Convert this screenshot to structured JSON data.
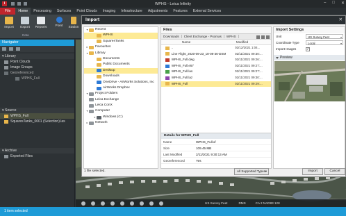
{
  "app": {
    "title": "WPHS - Leica Infinity",
    "app_icon": "i"
  },
  "ribbon": {
    "tabs": [
      "File",
      "Home",
      "Processing",
      "Surfaces",
      "Point Clouds",
      "Imaging",
      "Infrastructure",
      "Adjustments",
      "Features",
      "External Services"
    ],
    "active_tab": "Home",
    "buttons": [
      {
        "label": "Import",
        "icon": "import-icon"
      },
      {
        "label": "Export",
        "icon": "export-icon"
      },
      {
        "label": "Reports",
        "icon": "reports-icon"
      },
      {
        "label": "Point",
        "icon": "point-icon"
      },
      {
        "label": "Station",
        "icon": "station-icon"
      }
    ],
    "group_label": "Data"
  },
  "navigator": {
    "title": "Navigator",
    "library": {
      "label": "Library",
      "items": [
        "Point Clouds",
        "Image Groups",
        "Georeferenced",
        "WPHS_Full"
      ]
    },
    "source": {
      "label": "Source",
      "items": [
        "WPHS_Full",
        "SquaresTanks_0001 (Selection).las"
      ]
    },
    "archive": {
      "label": "Archive",
      "items": [
        "Exported Files"
      ]
    }
  },
  "dialog": {
    "title": "Import",
    "tree": [
      {
        "label": "Recent",
        "icon": "folder",
        "level": 0,
        "arrow": "▾"
      },
      {
        "label": "WPHS",
        "icon": "folder",
        "level": 1,
        "selected": true
      },
      {
        "label": "SquaresTanks",
        "icon": "folder",
        "level": 1
      },
      {
        "label": "Favourites",
        "icon": "folder",
        "level": 0,
        "arrow": "▸"
      },
      {
        "label": "Library",
        "icon": "folder",
        "level": 0,
        "arrow": "▾"
      },
      {
        "label": "Documents",
        "icon": "folder",
        "level": 1
      },
      {
        "label": "Public Documents",
        "icon": "folder",
        "level": 1
      },
      {
        "label": "Desktop",
        "icon": "folder-blue",
        "level": 1,
        "selected": true
      },
      {
        "label": "Downloads",
        "icon": "folder",
        "level": 1
      },
      {
        "label": "OneDrive - AirWorks Solutions, Inc",
        "icon": "cloud-blue",
        "level": 1
      },
      {
        "label": "AirWorks Dropbox",
        "icon": "folder-blue",
        "level": 1
      },
      {
        "label": "Project Folders",
        "icon": "folder-gray",
        "level": 0,
        "arrow": "▾"
      },
      {
        "label": "Leica Exchange",
        "icon": "folder-gray",
        "level": 0
      },
      {
        "label": "Leica ConX",
        "icon": "folder-gray",
        "level": 0
      },
      {
        "label": "Computer",
        "icon": "folder-gray",
        "level": 0,
        "arrow": "▾"
      },
      {
        "label": "Windows (C:)",
        "icon": "drive",
        "level": 1,
        "arrow": "▸"
      },
      {
        "label": "Network",
        "icon": "folder-gray",
        "level": 0,
        "arrow": "▸"
      }
    ],
    "files": {
      "title": "Files",
      "breadcrumbs": [
        "Downloads",
        "Client Exchange - Psomas",
        "WPHS"
      ],
      "columns": [
        "Name",
        "Modified"
      ],
      "rows": [
        {
          "name": "..",
          "modified": "02/12/2021 1:04...",
          "icon": "folder"
        },
        {
          "name": "Line Flight_2020-09-23_18-08-36-DSM",
          "modified": "02/11/2021 09:30:...",
          "icon": "folder"
        },
        {
          "name": "WPHS_Full.dwg",
          "modified": "02/11/2021 09:26:...",
          "icon": "file-dwg"
        },
        {
          "name": "WPHS_Full.e57",
          "modified": "02/11/2021 09:27:...",
          "icon": "file-e57"
        },
        {
          "name": "WPHS_Full.las",
          "modified": "02/11/2021 09:27:...",
          "icon": "file-las"
        },
        {
          "name": "WPHS_Full.laz",
          "modified": "02/11/2021 09:30:...",
          "icon": "file-laz"
        },
        {
          "name": "WPHS_Full",
          "modified": "02/11/2021 09:29:...",
          "icon": "folder",
          "selected": true
        }
      ]
    },
    "details": {
      "title": "Details for WPHS_Full",
      "rows": [
        {
          "key": "Name",
          "value": "WPHS_Full.xf"
        },
        {
          "key": "Size",
          "value": "109.45 MB"
        },
        {
          "key": "Last Modified",
          "value": "2/11/2021 9:30:13 AM"
        },
        {
          "key": "Georeferenced",
          "value": "Yes"
        }
      ]
    },
    "settings": {
      "title": "Import Settings",
      "unit_label": "Unit",
      "unit_value": "US Survey Feet",
      "coord_label": "Coordinate Type",
      "coord_value": "Local",
      "images_label": "Import Images",
      "images_checked": "✓",
      "preview_label": "Preview"
    },
    "footer": {
      "status": "1 file selected.",
      "filter": "All Supported Types",
      "import": "Import",
      "cancel": "Cancel"
    }
  },
  "viewbar": {
    "units": "US Survey Feet",
    "format": "DMS",
    "crs": "CA 2 NAD83 128"
  },
  "status": {
    "text": "1 item selected"
  }
}
